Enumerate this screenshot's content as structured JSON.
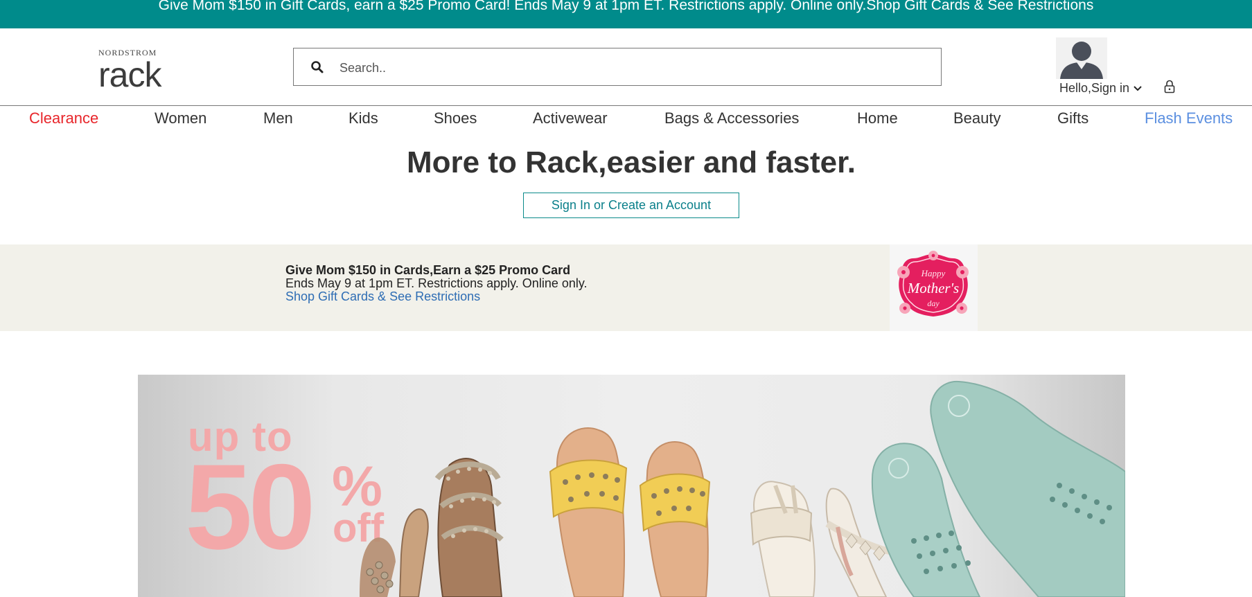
{
  "topbar": {
    "text": "Give Mom $150 in Gift Cards, earn a $25 Promo Card! Ends May 9 at 1pm ET. Restrictions apply. Online only.",
    "link": "Shop Gift Cards & See Restrictions"
  },
  "logo": {
    "small": "NORDSTROM",
    "big": "rack"
  },
  "search": {
    "placeholder": "Search.."
  },
  "account": {
    "label": "Hello,Sign in"
  },
  "nav": [
    {
      "label": "Clearance",
      "color": "#e8262b"
    },
    {
      "label": "Women"
    },
    {
      "label": "Men"
    },
    {
      "label": "Kids"
    },
    {
      "label": "Shoes"
    },
    {
      "label": "Activewear"
    },
    {
      "label": "Bags & Accessories"
    },
    {
      "label": "Home"
    },
    {
      "label": "Beauty"
    },
    {
      "label": "Gifts"
    },
    {
      "label": "Flash Events",
      "color": "#5b8fe0"
    }
  ],
  "hero": {
    "headline": "More to Rack,easier and faster.",
    "button": "Sign In or Create an Account"
  },
  "promo": {
    "title": "Give Mom $150 in Cards,Earn a $25 Promo Card",
    "subtitle": "Ends May 9 at 1pm ET. Restrictions apply. Online only.",
    "link": "Shop Gift Cards & See Restrictions",
    "badge": {
      "line1": "Happy",
      "line2": "Mother's",
      "line3": "day"
    }
  },
  "banner": {
    "upto": "up to",
    "percent": "50",
    "sign": "%",
    "off": "off"
  },
  "colors": {
    "brand": "#008b8b",
    "sale": "#f3a8a9",
    "clearance": "#e8262b",
    "flash": "#5b8fe0"
  }
}
